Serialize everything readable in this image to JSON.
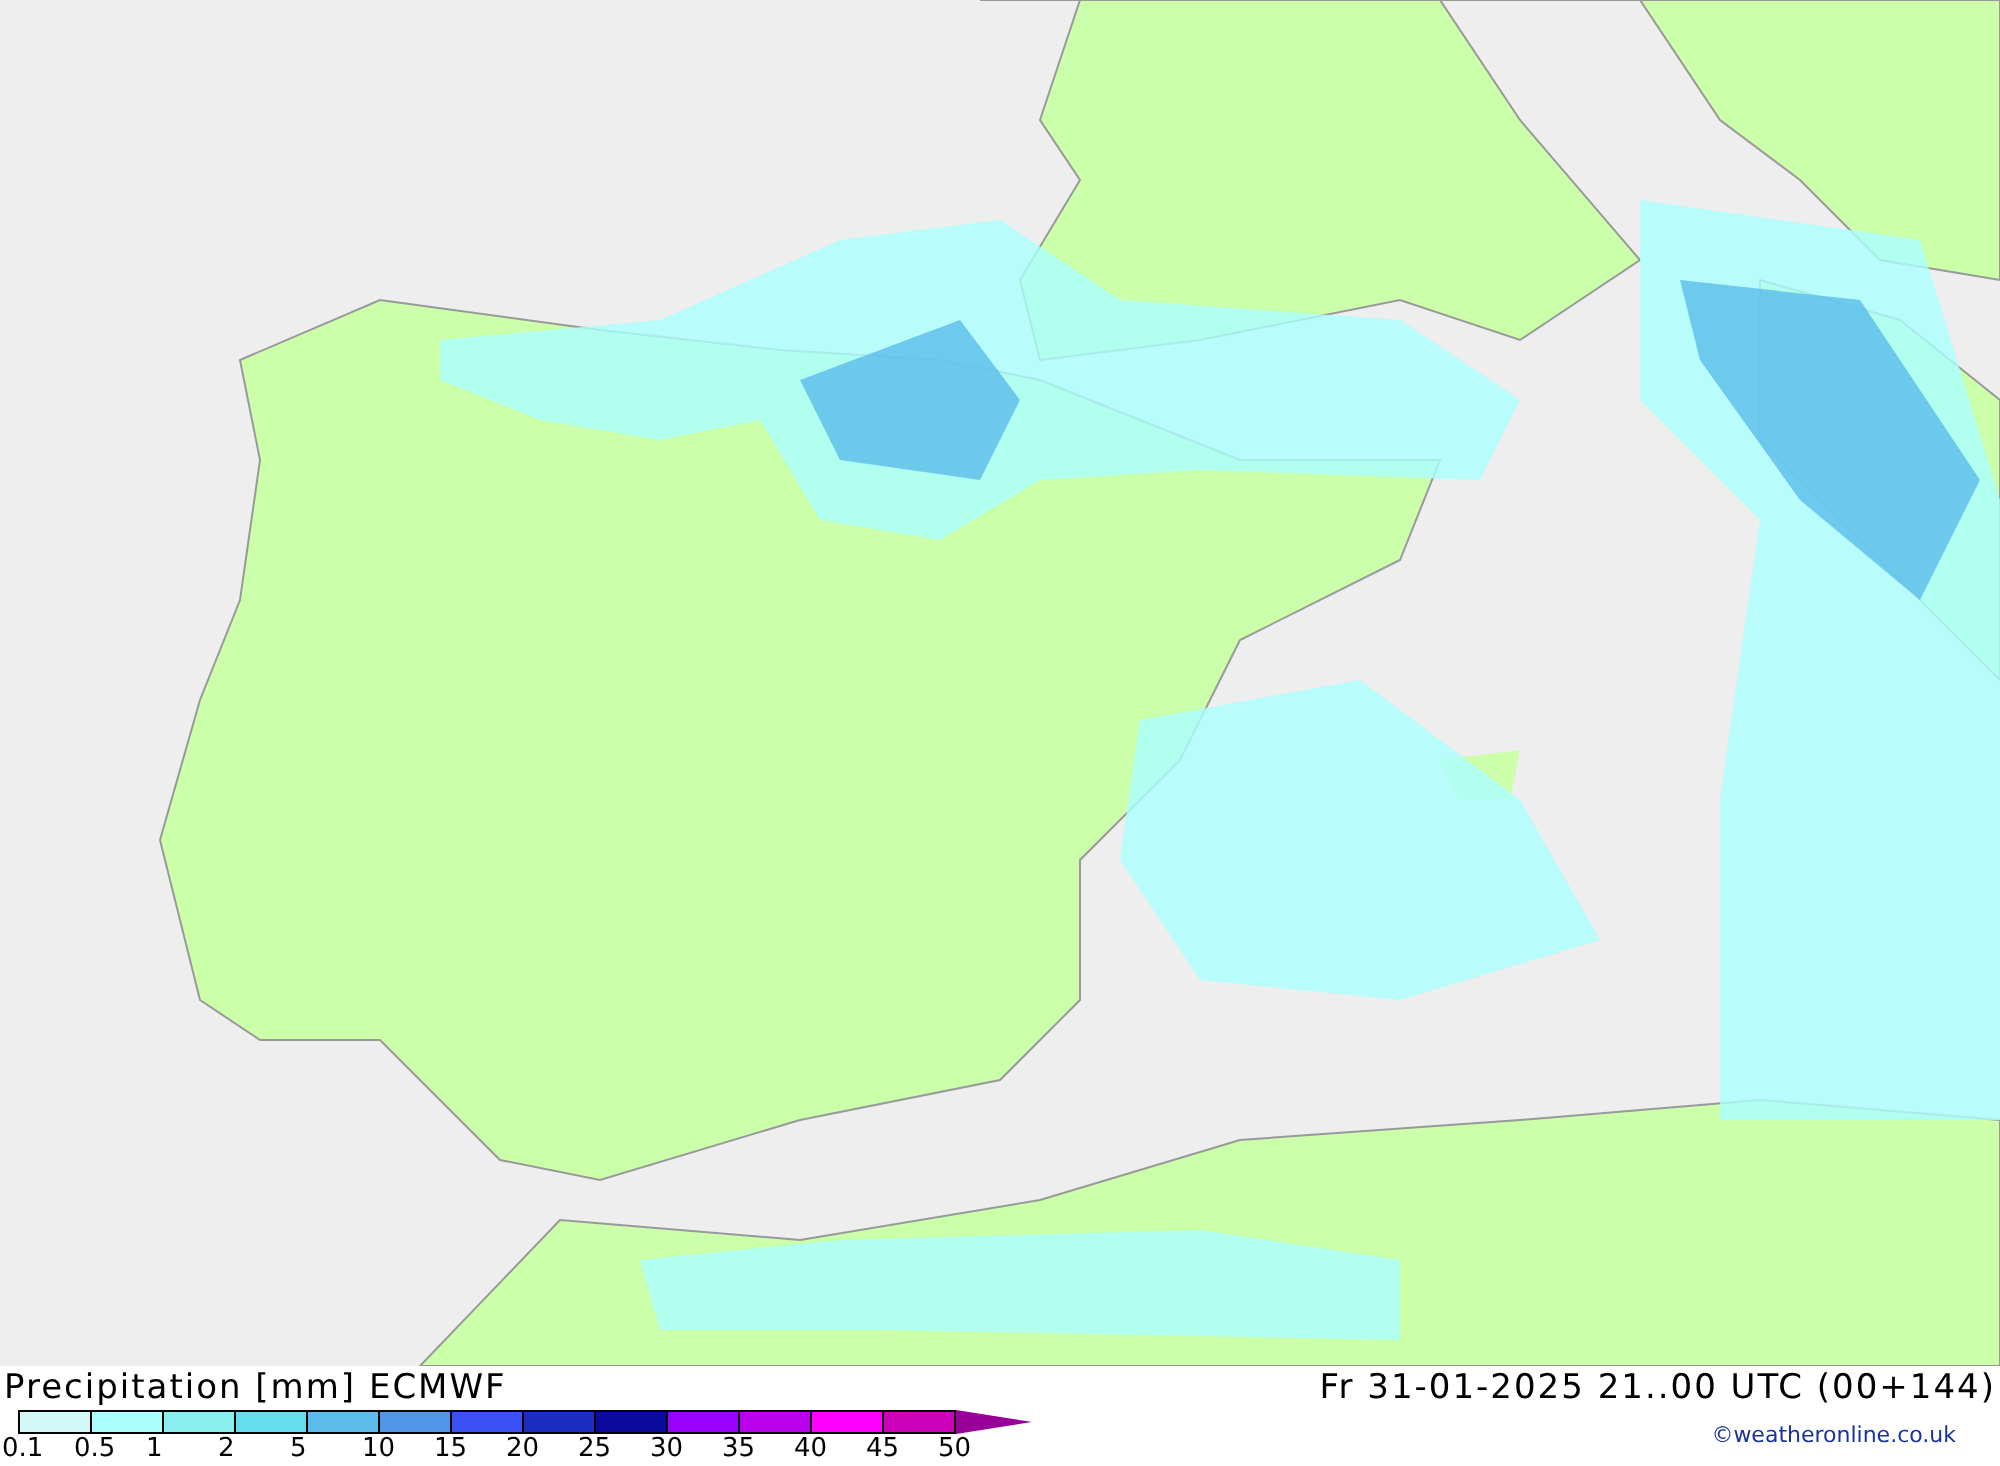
{
  "title": "Precipitation [mm] ECMWF",
  "valid_time": "Fr 31-01-2025 21..00 UTC (00+144)",
  "legend": {
    "swatches": [
      {
        "color": "#d4f7f7"
      },
      {
        "color": "#aaffff"
      },
      {
        "color": "#88eeee"
      },
      {
        "color": "#66dded"
      },
      {
        "color": "#5bbbea"
      },
      {
        "color": "#5095e8"
      },
      {
        "color": "#3b50f5"
      },
      {
        "color": "#1c2dc2"
      },
      {
        "color": "#0a0a9e"
      },
      {
        "color": "#9900ff"
      },
      {
        "color": "#bb00ee"
      },
      {
        "color": "#ff00ff"
      },
      {
        "color": "#cc00bb"
      }
    ],
    "labels": [
      "0.1",
      "0.5",
      "1",
      "2",
      "5",
      "10",
      "15",
      "20",
      "25",
      "30",
      "35",
      "40",
      "45",
      "50"
    ]
  },
  "credit": "©weatheronline.co.uk"
}
